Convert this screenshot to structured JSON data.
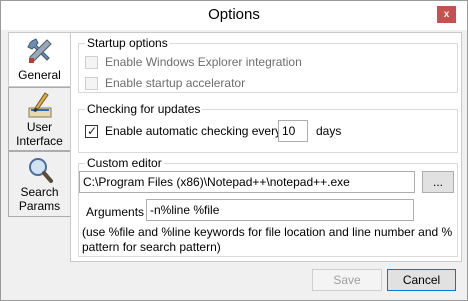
{
  "window": {
    "title": "Options",
    "close_label": "x"
  },
  "tabs": [
    {
      "id": "general",
      "label": "General",
      "icon": "tools-icon",
      "active": true
    },
    {
      "id": "user-interface",
      "label_line1": "User",
      "label_line2": "Interface",
      "icon": "paint-brush-icon",
      "active": false
    },
    {
      "id": "search-params",
      "label_line1": "Search",
      "label_line2": "Params",
      "icon": "magnifier-icon",
      "active": false
    }
  ],
  "startup": {
    "title": "Startup options",
    "explorer_integration": {
      "label": "Enable Windows Explorer integration",
      "checked": false,
      "enabled": false
    },
    "startup_accelerator": {
      "label": "Enable startup accelerator",
      "checked": false,
      "enabled": false
    }
  },
  "updates": {
    "title": "Checking for updates",
    "auto_check": {
      "label": "Enable automatic checking every",
      "checked": true
    },
    "days_value": "10",
    "days_label": "days"
  },
  "editor": {
    "title": "Custom editor",
    "path_value": "C:\\Program Files (x86)\\Notepad++\\notepad++.exe",
    "browse_label": "...",
    "arguments_label": "Arguments",
    "arguments_value": "-n%line %file",
    "hint_line1": "(use %file and %line keywords for file location and line number and %",
    "hint_line2": "pattern for search pattern)"
  },
  "footer": {
    "save_label": "Save",
    "save_enabled": false,
    "cancel_label": "Cancel"
  },
  "colors": {
    "accent": "#0078d7",
    "close_button": "#c75050"
  }
}
